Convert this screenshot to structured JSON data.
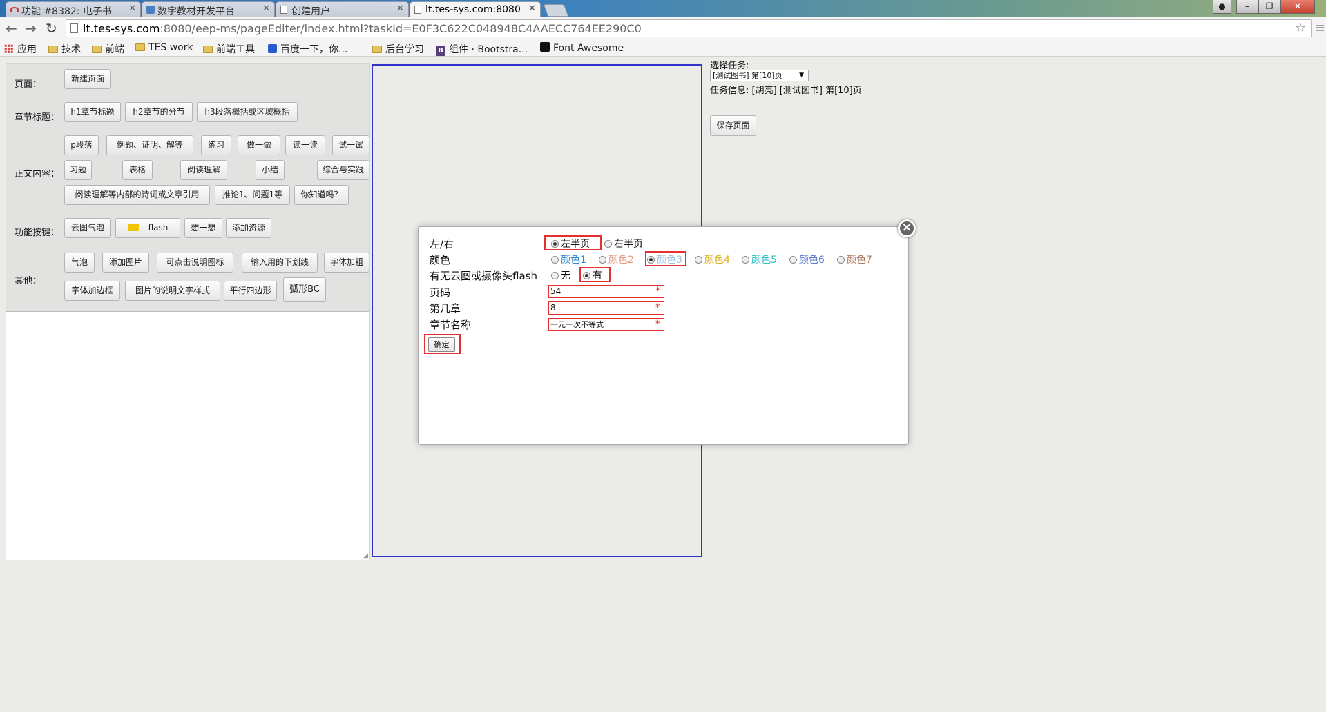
{
  "browser": {
    "tabs": [
      {
        "label": "功能 #8382: 电子书"
      },
      {
        "label": "数字教材开发平台"
      },
      {
        "label": "创建用户"
      },
      {
        "label": "lt.tes-sys.com:8080"
      }
    ],
    "url_host": "lt.tes-sys.com",
    "url_rest": ":8080/eep-ms/pageEditer/index.html?taskId=E0F3C622C048948C4AAECC764EE290C0",
    "bookmarks": [
      "应用",
      "技术",
      "前端",
      "TES work",
      "前端工具",
      "百度一下，你...",
      "后台学习",
      "组件 · Bootstra...",
      "Font Awesome"
    ]
  },
  "left": {
    "page_label": "页面：",
    "new_page": "新建页面",
    "chapter_label": "章节标题：",
    "chapter_buttons": [
      "h1章节标题",
      "h2章节的分节",
      "h3段落概括或区域概括"
    ],
    "body_label": "正文内容：",
    "body_buttons": [
      "p段落",
      "例题、证明、解等",
      "练习",
      "做一做",
      "读一读",
      "试一试",
      "习题",
      "表格",
      "阅读理解",
      "小结",
      "综合与实践",
      "阅读理解等内部的诗词或文章引用",
      "推论1、问题1等",
      "你知道吗？"
    ],
    "func_label": "功能按键：",
    "func_buttons": [
      "云图气泡",
      "flash",
      "想一想",
      "添加资源"
    ],
    "other_label": "其他：",
    "other_buttons": [
      "气泡",
      "添加图片",
      "可点击说明图标",
      "输入用的下划线",
      "字体加粗",
      "字体加边框",
      "图片的说明文字样式",
      "平行四边形",
      "弧形BC"
    ]
  },
  "right": {
    "select_task_label": "选择任务:",
    "select_value": "[测试图书] 第[10]页",
    "task_info": "任务信息: [胡亮] [测试图书] 第[10]页",
    "save_button": "保存页面"
  },
  "modal": {
    "side_label": "左/右",
    "side_options": [
      "左半页",
      "右半页"
    ],
    "side_selected": 0,
    "color_label": "颜色",
    "color_options": [
      "颜色1",
      "颜色2",
      "颜色3",
      "颜色4",
      "颜色5",
      "颜色6",
      "颜色7"
    ],
    "color_values": [
      "#2a8ad8",
      "#e89a80",
      "#9cc2e6",
      "#e0b020",
      "#30c0c8",
      "#5a78d0",
      "#b07860"
    ],
    "color_selected": 2,
    "flash_label": "有无云图或摄像头flash",
    "flash_options": [
      "无",
      "有"
    ],
    "flash_selected": 1,
    "page_label": "页码",
    "page_value": "54",
    "chapter_label": "第几章",
    "chapter_value": "8",
    "chapter_name_label": "章节名称",
    "chapter_name_value": "一元一次不等式",
    "required_mark": "*",
    "ok_button": "确定"
  }
}
